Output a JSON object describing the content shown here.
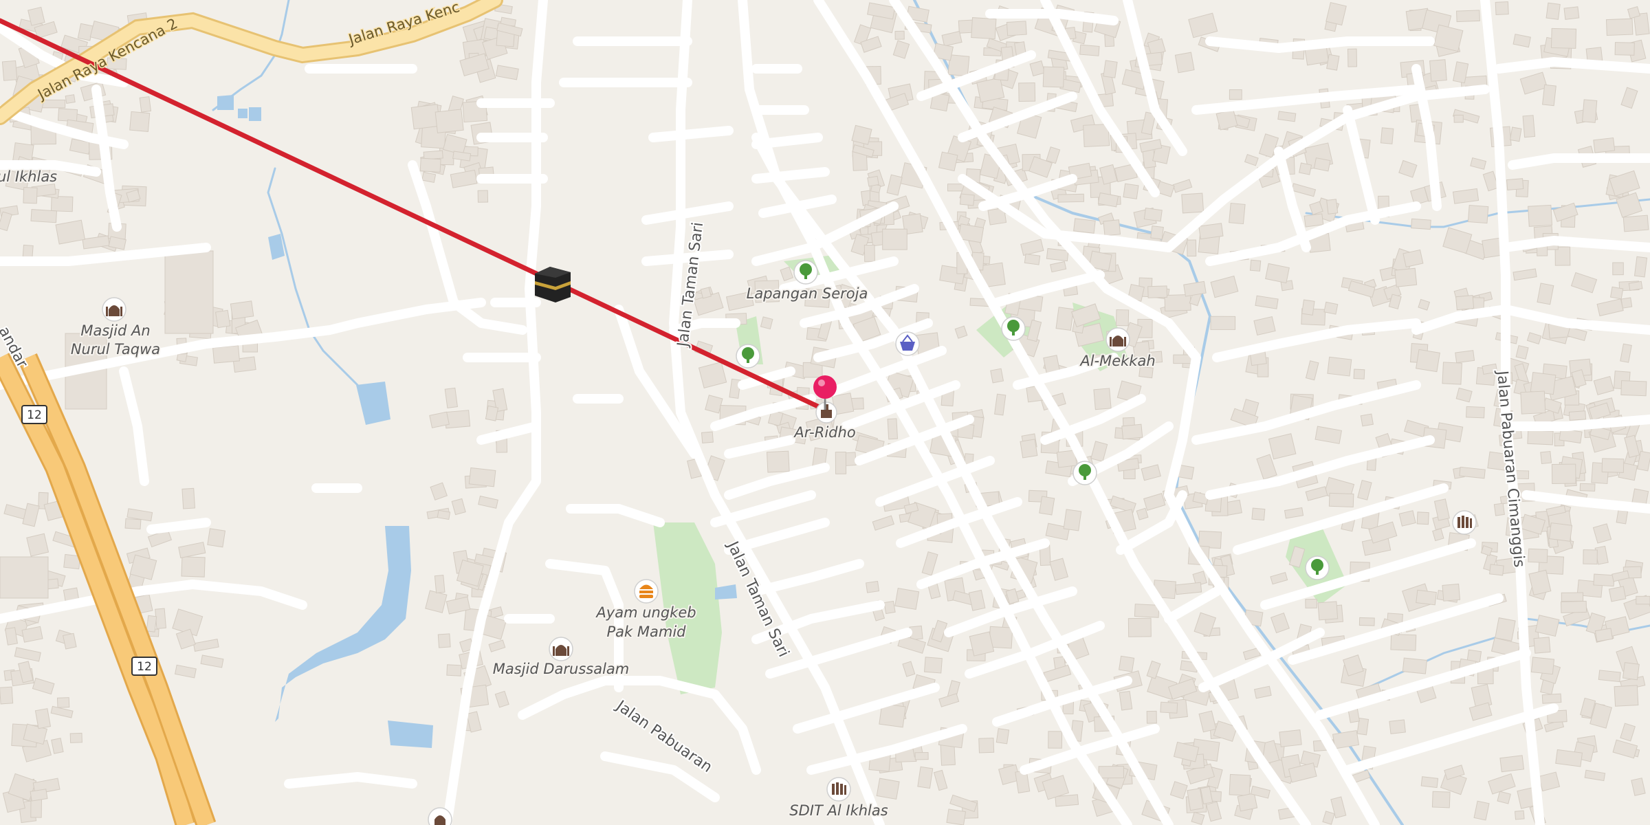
{
  "map": {
    "colors": {
      "background": "#f2efe9",
      "water": "#a8cbe8",
      "park": "#cde8c2",
      "highway": "#f8c978",
      "route_line": "#d3222e",
      "pin": "#e91e63"
    },
    "route_line": {
      "from": "off-map (top-left)",
      "via": "kaaba-icon",
      "to": "Ar-Ridho"
    },
    "roads": [
      {
        "name": "Jalan Raya Kencana 2"
      },
      {
        "name": "Jalan Raya Kenc"
      },
      {
        "name": "Jalan Taman Sari",
        "instance": 1
      },
      {
        "name": "Jalan Taman Sari",
        "instance": 2
      },
      {
        "name": "Jalan Pabuaran"
      },
      {
        "name": "Jalan Pabuaran Cimanggis"
      },
      {
        "name": "andar"
      }
    ],
    "route_shields": [
      "12",
      "12"
    ],
    "pois": [
      {
        "name": "Ar-Ridho",
        "type": "place-of-worship",
        "icon": "pin-icon"
      },
      {
        "name": "Lapangan Seroja",
        "type": "park",
        "icon": "tree-icon"
      },
      {
        "name": "Al-Mekkah",
        "type": "mosque",
        "icon": "mosque-icon"
      },
      {
        "name": "Masjid An",
        "name_line2": "Nurul Taqwa",
        "type": "mosque",
        "icon": "mosque-icon"
      },
      {
        "name": "ul Ikhlas",
        "type": "mosque",
        "icon": "mosque-icon"
      },
      {
        "name": "Ayam ungkeb",
        "name_line2": "Pak Mamid",
        "type": "restaurant",
        "icon": "burger-icon"
      },
      {
        "name": "Masjid Darussalam",
        "type": "mosque",
        "icon": "mosque-icon"
      },
      {
        "name": "SDIT Al Ikhlas",
        "type": "school",
        "icon": "school-icon"
      }
    ],
    "extra_icons": [
      "shopping-basket-icon",
      "tree-icon",
      "tree-icon",
      "tree-icon",
      "tree-icon",
      "school-icon",
      "mosque-icon",
      "kaaba-icon"
    ]
  }
}
